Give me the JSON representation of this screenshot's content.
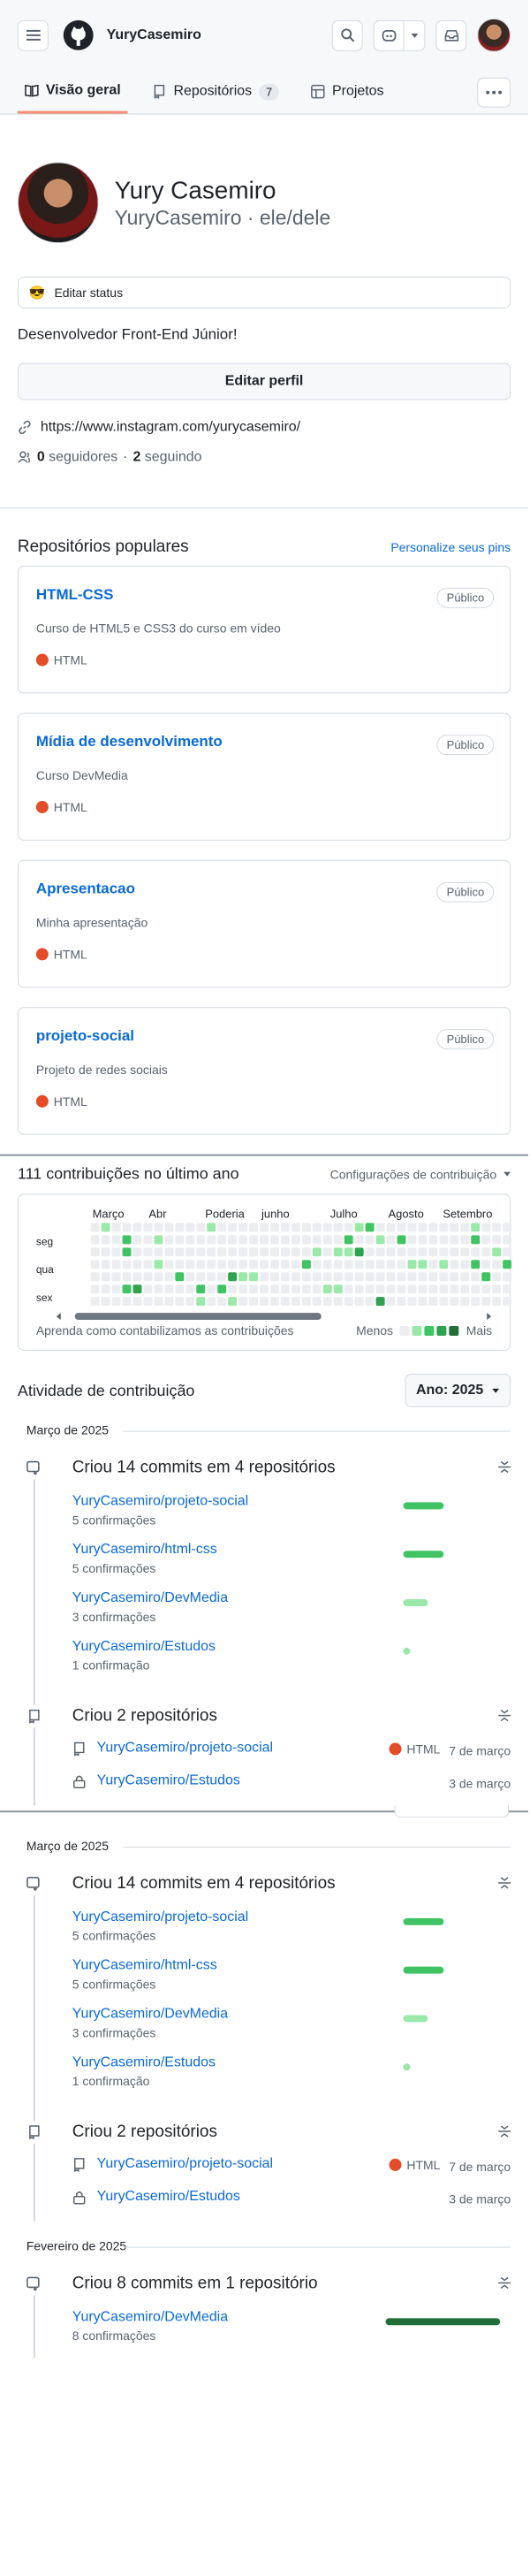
{
  "header": {
    "username": "YuryCasemiro"
  },
  "tabs": [
    {
      "label": "Visão geral"
    },
    {
      "label": "Repositórios",
      "count": "7"
    },
    {
      "label": "Projetos"
    }
  ],
  "profile": {
    "name": "Yury Casemiro",
    "login": "YuryCasemiro · ele/dele",
    "status": "Editar status",
    "bio": "Desenvolvedor Front-End Júnior!",
    "edit_button": "Editar perfil",
    "link": "https://www.instagram.com/yurycasemiro/",
    "followers": "0",
    "followers_label": "seguidores",
    "following": "2",
    "following_label": "seguindo"
  },
  "popular": {
    "title": "Repositórios populares",
    "customize": "Personalize seus pins",
    "repos": [
      {
        "name": "HTML-CSS",
        "badge": "Público",
        "desc": "Curso de HTML5 e CSS3 do curso em vídeo",
        "lang": "HTML"
      },
      {
        "name": "Mídia de desenvolvimento",
        "badge": "Público",
        "desc": "Curso DevMedia",
        "lang": "HTML"
      },
      {
        "name": "Apresentacao",
        "badge": "Público",
        "desc": "Minha apresentação",
        "lang": "HTML"
      },
      {
        "name": "projeto-social",
        "badge": "Público",
        "desc": "Projeto de redes sociais",
        "lang": "HTML"
      }
    ]
  },
  "contrib": {
    "title": "111 contribuições no último ano",
    "settings": "Configurações de contribuição",
    "months": [
      "Março",
      "Abr",
      "Poderia",
      "junho",
      "Julho",
      "Agosto",
      "Setembro"
    ],
    "days": [
      "seg",
      "qua",
      "sex"
    ],
    "learn": "Aprenda como contabilizamos as contribuições",
    "less": "Menos",
    "more": "Mais",
    "colors": [
      "#ebedf0",
      "#9be9a8",
      "#40c463",
      "#30a14e",
      "#216e39"
    ]
  },
  "activity": {
    "title": "Atividade de contribuição",
    "year": "Ano: 2025",
    "section1": {
      "month": "Março de 2025",
      "commits_title": "Criou 14 commits em 4 repositórios",
      "commits": [
        {
          "repo": "YuryCasemiro/projeto-social",
          "count": "5 confirmações",
          "level": 5
        },
        {
          "repo": "YuryCasemiro/html-css",
          "count": "5 confirmações",
          "level": 5
        },
        {
          "repo": "YuryCasemiro/DevMedia",
          "count": "3 confirmações",
          "level": 3
        },
        {
          "repo": "YuryCasemiro/Estudos",
          "count": "1 confirmação",
          "level": 1
        }
      ],
      "repos_title": "Criou 2 repositórios",
      "repos": [
        {
          "name": "YuryCasemiro/projeto-social",
          "lang": "HTML",
          "date": "7 de março",
          "icon": "repo-icon"
        },
        {
          "name": "YuryCasemiro/Estudos",
          "lang": "",
          "date": "3 de março",
          "icon": "lock-icon"
        }
      ]
    },
    "section2": {
      "month": "Março de 2025",
      "commits_title": "Criou 14 commits em 4 repositórios",
      "commits": [
        {
          "repo": "YuryCasemiro/projeto-social",
          "count": "5 confirmações",
          "level": 5
        },
        {
          "repo": "YuryCasemiro/html-css",
          "count": "5 confirmações",
          "level": 5
        },
        {
          "repo": "YuryCasemiro/DevMedia",
          "count": "3 confirmações",
          "level": 3
        },
        {
          "repo": "YuryCasemiro/Estudos",
          "count": "1 confirmação",
          "level": 1
        }
      ],
      "repos_title": "Criou 2 repositórios",
      "repos": [
        {
          "name": "YuryCasemiro/projeto-social",
          "lang": "HTML",
          "date": "7 de março",
          "icon": "repo-icon"
        },
        {
          "name": "YuryCasemiro/Estudos",
          "lang": "",
          "date": "3 de março",
          "icon": "lock-icon"
        }
      ]
    },
    "section3": {
      "month": "Fevereiro de 2025",
      "commits_title": "Criou 8 commits em 1 repositório",
      "commits": [
        {
          "repo": "YuryCasemiro/DevMedia",
          "count": "8 confirmações",
          "level": 8
        }
      ]
    }
  },
  "colors": {
    "accent": "#0969da",
    "tab_underline": "#fd8c73",
    "html_lang": "#e34c26",
    "bar_strong": "#40c463",
    "bar_mid": "#9be9a8",
    "bar_dark": "#216e39"
  }
}
